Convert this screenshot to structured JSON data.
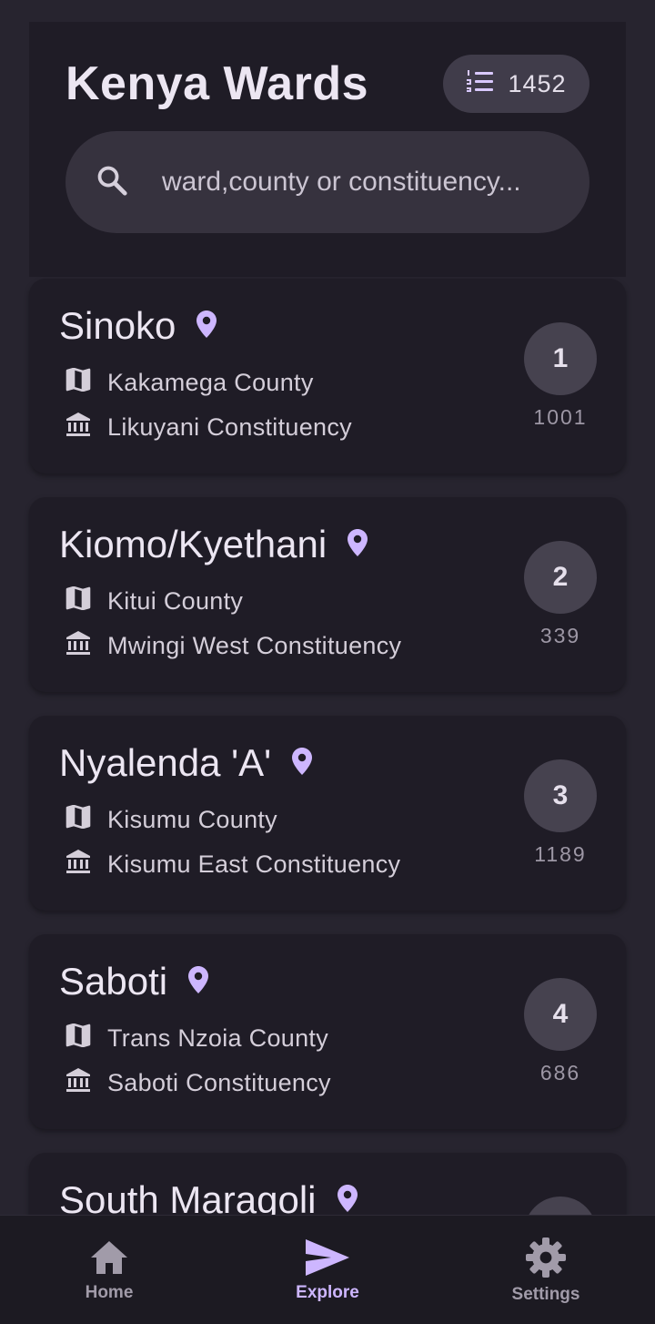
{
  "header": {
    "title": "Kenya Wards",
    "count_icon": "numbered-list-icon",
    "count": "1452",
    "search_icon": "search-icon",
    "search_placeholder": "ward,county or constituency..."
  },
  "wards": [
    {
      "name": "Sinoko",
      "county": "Kakamega County",
      "constituency": "Likuyani Constituency",
      "rank": "1",
      "code": "1001"
    },
    {
      "name": "Kiomo/Kyethani",
      "county": "Kitui County",
      "constituency": "Mwingi West Constituency",
      "rank": "2",
      "code": "339"
    },
    {
      "name": "Nyalenda 'A'",
      "county": "Kisumu County",
      "constituency": "Kisumu East Constituency",
      "rank": "3",
      "code": "1189"
    },
    {
      "name": "Saboti",
      "county": "Trans Nzoia County",
      "constituency": "Saboti Constituency",
      "rank": "4",
      "code": "686"
    },
    {
      "name": "South Maragoli",
      "county": "",
      "constituency": "",
      "rank": "",
      "code": ""
    }
  ],
  "icons": {
    "location": "location-pin-icon",
    "county": "map-icon",
    "constituency": "bank-institution-icon"
  },
  "colors": {
    "accent": "#cdb6ff",
    "background": "#27242f",
    "card": "#1f1c26"
  },
  "bottom_nav": {
    "home_label": "Home",
    "explore_label": "Explore",
    "settings_label": "Settings",
    "active": "Explore"
  }
}
